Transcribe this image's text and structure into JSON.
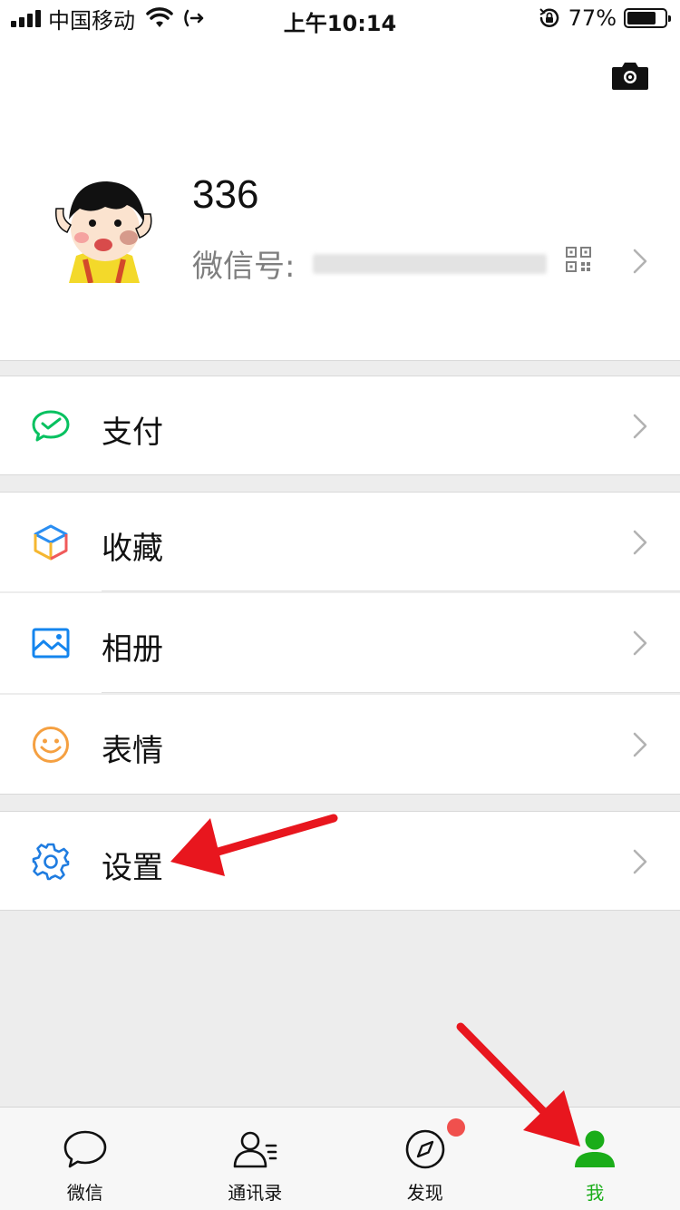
{
  "status_bar": {
    "carrier": "中国移动",
    "time": "上午10:14",
    "battery_pct": "77%",
    "battery_level": 0.77
  },
  "profile": {
    "nickname": "336",
    "wechat_id_label": "微信号:",
    "icons": [
      "camera-icon",
      "qrcode-icon",
      "chevron-right-icon"
    ]
  },
  "menu": {
    "pay": "支付",
    "favorites": "收藏",
    "album": "相册",
    "stickers": "表情",
    "settings": "设置"
  },
  "tabbar": {
    "items": [
      {
        "label": "微信",
        "icon": "chat-icon"
      },
      {
        "label": "通讯录",
        "icon": "contacts-icon"
      },
      {
        "label": "发现",
        "icon": "discover-icon"
      },
      {
        "label": "我",
        "icon": "me-icon"
      }
    ],
    "active_color": "#1aad19",
    "badge_color": "#f0504d"
  },
  "colors": {
    "pay_green": "#07c160",
    "album_blue": "#1485ee",
    "sticker_orange": "#f5a041",
    "settings_blue": "#1f7ce0",
    "annotation_red": "#e8161e"
  }
}
